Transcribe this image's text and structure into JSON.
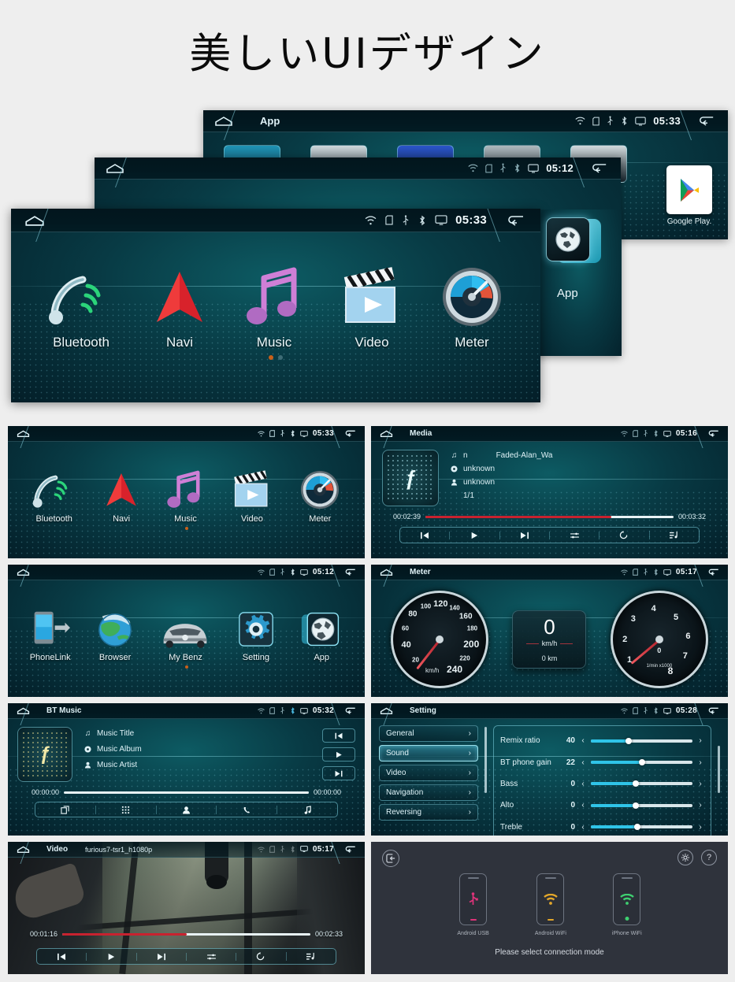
{
  "page": {
    "title": "美しいUIデザイン",
    "background": "#eeeeee"
  },
  "colors": {
    "accent_cyan": "#2fc4e8",
    "screen_teal": "#0d5b63",
    "progress_red": "#c8222f",
    "dot_orange": "#c8601a",
    "conn_bg": "#2f333c"
  },
  "status_icons": [
    "wifi-icon",
    "sd-card-icon",
    "usb-icon",
    "bluetooth-icon",
    "monitor-icon"
  ],
  "hero": {
    "top": {
      "title": "App",
      "time": "05:33",
      "apps": [
        {
          "label": "Google Play.",
          "icon": "google-play-icon"
        }
      ]
    },
    "middle": {
      "title": "",
      "time": "05:12"
    },
    "front": {
      "title": "",
      "time": "05:33",
      "apps": [
        {
          "label": "Bluetooth",
          "icon": "bluetooth-phone-icon"
        },
        {
          "label": "Navi",
          "icon": "navigation-arrow-icon"
        },
        {
          "label": "Music",
          "icon": "music-note-icon"
        },
        {
          "label": "Video",
          "icon": "clapperboard-icon"
        },
        {
          "label": "Meter",
          "icon": "gauge-icon"
        }
      ],
      "overlay_app": {
        "label": "App",
        "icon": "globe-icon"
      }
    }
  },
  "panels": {
    "home1": {
      "title": "",
      "time": "05:33",
      "apps": [
        {
          "label": "Bluetooth",
          "icon": "bluetooth-phone-icon"
        },
        {
          "label": "Navi",
          "icon": "navigation-arrow-icon"
        },
        {
          "label": "Music",
          "icon": "music-note-icon"
        },
        {
          "label": "Video",
          "icon": "clapperboard-icon"
        },
        {
          "label": "Meter",
          "icon": "gauge-icon"
        }
      ]
    },
    "media": {
      "title": "Media",
      "time": "05:16",
      "track_title": "Faded-Alan_Wa",
      "track_prefix": "n",
      "album": "unknown",
      "artist": "unknown",
      "track_index": "1/1",
      "elapsed": "00:02:39",
      "duration": "00:03:32",
      "progress_percent": 75,
      "controls": [
        "prev-icon",
        "play-icon",
        "next-icon",
        "shuffle-icon",
        "repeat-icon",
        "playlist-icon"
      ]
    },
    "home2": {
      "title": "",
      "time": "05:12",
      "apps": [
        {
          "label": "PhoneLink",
          "icon": "phonelink-icon"
        },
        {
          "label": "Browser",
          "icon": "globe-browser-icon"
        },
        {
          "label": "My Benz",
          "icon": "car-icon"
        },
        {
          "label": "Setting",
          "icon": "gear-icon"
        },
        {
          "label": "App",
          "icon": "globe-icon"
        }
      ]
    },
    "meter": {
      "title": "Meter",
      "time": "05:17",
      "speedometer": {
        "ticks": [
          "20",
          "40",
          "60",
          "80",
          "100",
          "120",
          "140",
          "160",
          "180",
          "200",
          "220",
          "240"
        ],
        "unit": "km/h",
        "value": 0
      },
      "center": {
        "value": "0",
        "unit": "km/h",
        "odometer": "0 km"
      },
      "tachometer": {
        "ticks": [
          "1",
          "2",
          "3",
          "4",
          "5",
          "6",
          "7",
          "8"
        ],
        "unit": "1/min x1000",
        "value_label": "0"
      }
    },
    "btmusic": {
      "title": "BT Music",
      "time": "05:32",
      "track_title": "Music Title",
      "album": "Music Album",
      "artist": "Music Artist",
      "elapsed": "00:00:00",
      "duration": "00:00:00",
      "progress_percent": 0,
      "side_controls": [
        "prev-icon",
        "play-icon",
        "next-icon"
      ],
      "bottom_tabs": [
        "dialpad-copy-icon",
        "keypad-icon",
        "contacts-icon",
        "call-log-icon",
        "music-icon"
      ]
    },
    "setting": {
      "title": "Setting",
      "time": "05:28",
      "menu": [
        {
          "label": "General",
          "active": false
        },
        {
          "label": "Sound",
          "active": true
        },
        {
          "label": "Video",
          "active": false
        },
        {
          "label": "Navigation",
          "active": false
        },
        {
          "label": "Reversing",
          "active": false
        }
      ],
      "sliders": [
        {
          "label": "Remix ratio",
          "value": "40",
          "percent": 37
        },
        {
          "label": "BT phone gain",
          "value": "22",
          "percent": 50
        },
        {
          "label": "Bass",
          "value": "0",
          "percent": 44
        },
        {
          "label": "Alto",
          "value": "0",
          "percent": 44
        },
        {
          "label": "Treble",
          "value": "0",
          "percent": 46
        }
      ]
    },
    "video": {
      "title": "Video",
      "filename": "furious7-tsr1_h1080p",
      "time": "05:17",
      "elapsed": "00:01:16",
      "duration": "00:02:33",
      "progress_percent": 50,
      "controls": [
        "prev-icon",
        "play-icon",
        "next-icon",
        "shuffle-icon",
        "repeat-icon",
        "playlist-icon"
      ]
    },
    "connection": {
      "hint": "Please select connection mode",
      "back_icon": "exit-icon",
      "top_right_icons": [
        "gear-icon",
        "help-icon"
      ],
      "modes": [
        {
          "label": "Android USB",
          "icon": "usb-icon",
          "color": "#e0337a"
        },
        {
          "label": "Android WiFi",
          "icon": "wifi-icon",
          "color": "#e2a62a"
        },
        {
          "label": "iPhone WiFi",
          "icon": "wifi-icon",
          "color": "#3ecf70"
        }
      ]
    }
  }
}
